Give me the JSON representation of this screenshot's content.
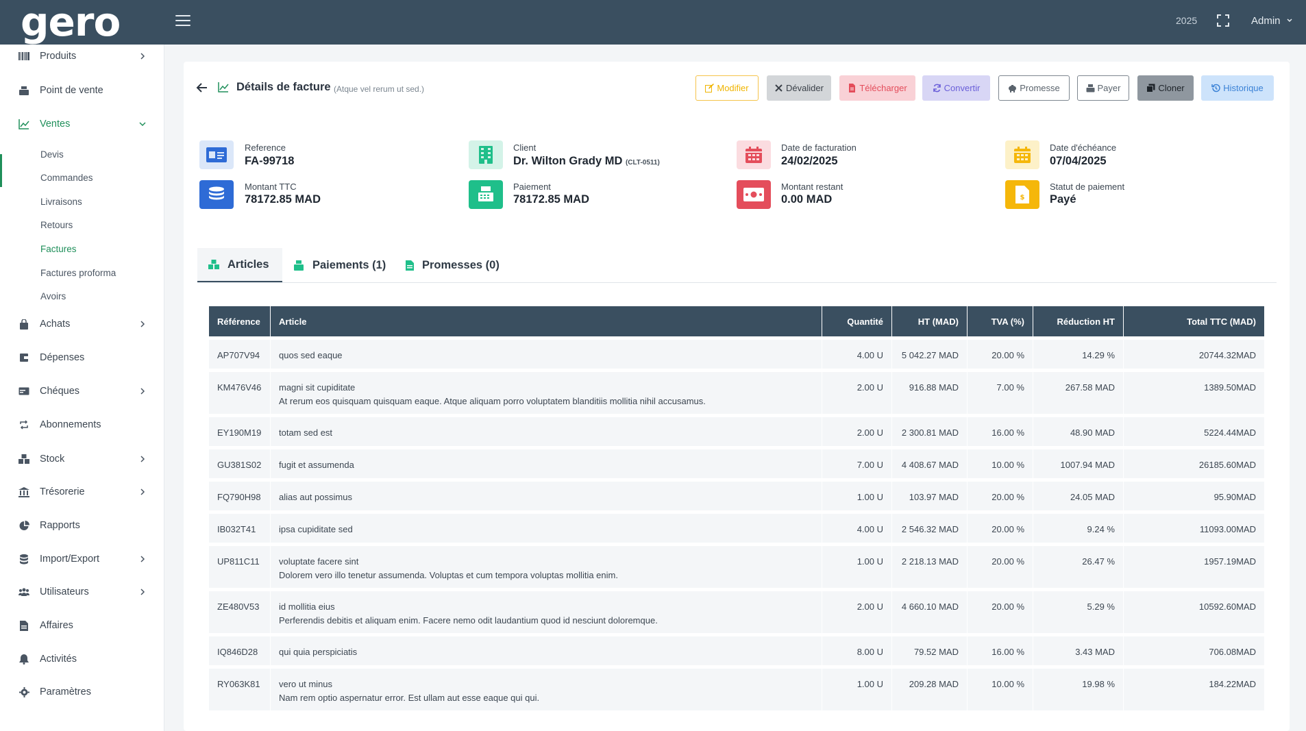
{
  "topbar": {
    "logo": "Gero",
    "year": "2025",
    "user": "Admin"
  },
  "sidebar": {
    "items": [
      {
        "label": "Produits"
      },
      {
        "label": "Point de vente"
      },
      {
        "label": "Ventes"
      },
      {
        "label": "Achats"
      },
      {
        "label": "Dépenses"
      },
      {
        "label": "Chéques"
      },
      {
        "label": "Abonnements"
      },
      {
        "label": "Stock"
      },
      {
        "label": "Trésorerie"
      },
      {
        "label": "Rapports"
      },
      {
        "label": "Import/Export"
      },
      {
        "label": "Utilisateurs"
      },
      {
        "label": "Affaires"
      },
      {
        "label": "Activités"
      },
      {
        "label": "Paramètres"
      }
    ],
    "ventes_sub": [
      {
        "label": "Devis"
      },
      {
        "label": "Commandes"
      },
      {
        "label": "Livraisons"
      },
      {
        "label": "Retours"
      },
      {
        "label": "Factures"
      },
      {
        "label": "Factures proforma"
      },
      {
        "label": "Avoirs"
      }
    ]
  },
  "header": {
    "title": "Détails de facture",
    "subtitle": "(Atque vel rerum ut sed.)"
  },
  "actions": {
    "modifier": "Modifier",
    "devalider": "Dévalider",
    "telecharger": "Télécharger",
    "convertir": "Convertir",
    "promesse": "Promesse",
    "payer": "Payer",
    "cloner": "Cloner",
    "historique": "Historique"
  },
  "info": {
    "reference": {
      "label": "Reference",
      "value": "FA-99718"
    },
    "client": {
      "label": "Client",
      "value": "Dr. Wilton Grady MD",
      "code": "(CLT-0511)"
    },
    "date_facturation": {
      "label": "Date de facturation",
      "value": "24/02/2025"
    },
    "date_echeance": {
      "label": "Date d'échéance",
      "value": "07/04/2025"
    },
    "montant_ttc": {
      "label": "Montant TTC",
      "value": "78172.85 MAD"
    },
    "paiement": {
      "label": "Paiement",
      "value": "78172.85 MAD"
    },
    "montant_restant": {
      "label": "Montant restant",
      "value": "0.00 MAD"
    },
    "statut": {
      "label": "Statut de paiement",
      "value": "Payé"
    }
  },
  "tabs": [
    {
      "label": "Articles"
    },
    {
      "label": "Paiements (1)"
    },
    {
      "label": "Promesses (0)"
    }
  ],
  "table": {
    "headers": [
      "Référence",
      "Article",
      "Quantité",
      "HT (MAD)",
      "TVA (%)",
      "Réduction HT",
      "Total TTC (MAD)"
    ],
    "rows": [
      {
        "ref": "AP707V94",
        "article": "quos sed eaque",
        "desc": "",
        "qty": "4.00 U",
        "ht": "5 042.27 MAD",
        "tva": "20.00 %",
        "red": "14.29 %",
        "total": "20744.32MAD"
      },
      {
        "ref": "KM476V46",
        "article": "magni sit cupiditate",
        "desc": "At rerum eos quisquam quisquam eaque. Atque aliquam porro voluptatem blanditiis mollitia nihil accusamus.",
        "qty": "2.00 U",
        "ht": "916.88 MAD",
        "tva": "7.00 %",
        "red": "267.58 MAD",
        "total": "1389.50MAD"
      },
      {
        "ref": "EY190M19",
        "article": "totam sed est",
        "desc": "",
        "qty": "2.00 U",
        "ht": "2 300.81 MAD",
        "tva": "16.00 %",
        "red": "48.90 MAD",
        "total": "5224.44MAD"
      },
      {
        "ref": "GU381S02",
        "article": "fugit et assumenda",
        "desc": "",
        "qty": "7.00 U",
        "ht": "4 408.67 MAD",
        "tva": "10.00 %",
        "red": "1007.94 MAD",
        "total": "26185.60MAD"
      },
      {
        "ref": "FQ790H98",
        "article": "alias aut possimus",
        "desc": "",
        "qty": "1.00 U",
        "ht": "103.97 MAD",
        "tva": "20.00 %",
        "red": "24.05 MAD",
        "total": "95.90MAD"
      },
      {
        "ref": "IB032T41",
        "article": "ipsa cupiditate sed",
        "desc": "",
        "qty": "4.00 U",
        "ht": "2 546.32 MAD",
        "tva": "20.00 %",
        "red": "9.24 %",
        "total": "11093.00MAD"
      },
      {
        "ref": "UP811C11",
        "article": "voluptate facere sint",
        "desc": "Dolorem vero illo tenetur assumenda. Voluptas et cum tempora voluptas mollitia enim.",
        "qty": "1.00 U",
        "ht": "2 218.13 MAD",
        "tva": "20.00 %",
        "red": "26.47 %",
        "total": "1957.19MAD"
      },
      {
        "ref": "ZE480V53",
        "article": "id mollitia eius",
        "desc": "Perferendis debitis et aliquam enim. Facere nemo odit laudantium quod id nesciunt doloremque.",
        "qty": "2.00 U",
        "ht": "4 660.10 MAD",
        "tva": "20.00 %",
        "red": "5.29 %",
        "total": "10592.60MAD"
      },
      {
        "ref": "IQ846D28",
        "article": "qui quia perspiciatis",
        "desc": "",
        "qty": "8.00 U",
        "ht": "79.52 MAD",
        "tva": "16.00 %",
        "red": "3.43 MAD",
        "total": "706.08MAD"
      },
      {
        "ref": "RY063K81",
        "article": "vero ut minus",
        "desc": "Nam rem optio aspernatur error. Est ullam aut esse eaque qui qui.",
        "qty": "1.00 U",
        "ht": "209.28 MAD",
        "tva": "10.00 %",
        "red": "19.98 %",
        "total": "184.22MAD"
      }
    ]
  }
}
